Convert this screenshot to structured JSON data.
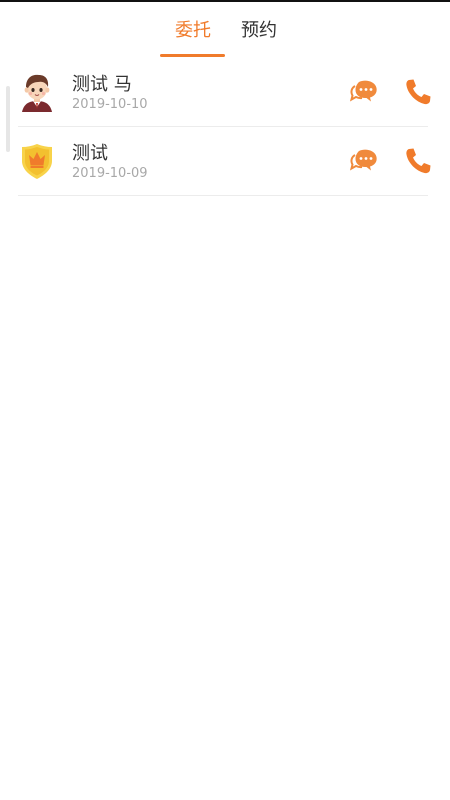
{
  "tabs": [
    {
      "label": "委托",
      "active": true
    },
    {
      "label": "预约",
      "active": false
    }
  ],
  "accent_color": "#f07b2b",
  "list": [
    {
      "name": "测试 马",
      "date": "2019-10-10",
      "avatar": "boy-avatar-icon"
    },
    {
      "name": "测试",
      "date": "2019-10-09",
      "avatar": "shield-crown-icon"
    }
  ]
}
